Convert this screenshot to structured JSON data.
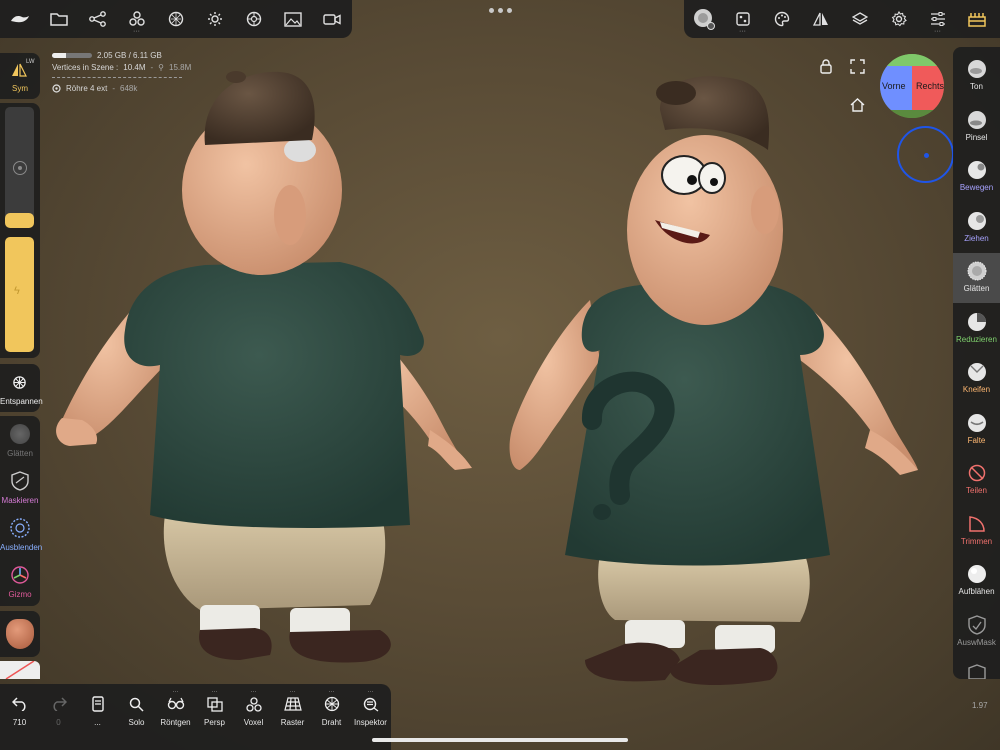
{
  "top_left_tools": [
    {
      "name": "logo-icon"
    },
    {
      "name": "folder-icon"
    },
    {
      "name": "scene-graph-icon"
    },
    {
      "name": "primitives-icon",
      "has_menu": true
    },
    {
      "name": "material-icon"
    },
    {
      "name": "light-icon"
    },
    {
      "name": "environment-icon"
    },
    {
      "name": "image-icon"
    },
    {
      "name": "video-icon"
    }
  ],
  "top_right_tools": [
    {
      "name": "brush-preview-icon"
    },
    {
      "name": "stroke-icon",
      "has_menu": true
    },
    {
      "name": "palette-icon"
    },
    {
      "name": "symmetry-icon"
    },
    {
      "name": "layers-icon"
    },
    {
      "name": "settings-icon"
    },
    {
      "name": "sliders-icon",
      "has_menu": true
    },
    {
      "name": "scene-icon"
    }
  ],
  "info": {
    "memory": "2.05 GB / 6.11 GB",
    "memory_fraction": 0.34,
    "vertices_label": "Vertices in Szene :",
    "vertices_value": "10.4M",
    "vertices_sep": "-",
    "vertices_total": "15.8M",
    "object_name": "Röhre 4 ext",
    "object_sep": "-",
    "object_count": "648k"
  },
  "left": {
    "sym_label": "Sym",
    "sym_badge": "LW",
    "relax_label": "Entspannen",
    "smooth_label": "Glätten",
    "mask_label": "Maskieren",
    "hide_label": "Ausblenden",
    "gizmo_label": "Gizmo"
  },
  "right_tools": [
    {
      "label": "Ton",
      "icon": "clay-brush-icon",
      "color": "#e6e6e6"
    },
    {
      "label": "Pinsel",
      "icon": "brush-icon",
      "color": "#e6e6e6"
    },
    {
      "label": "Bewegen",
      "icon": "move-icon",
      "color": "#a8a3ff"
    },
    {
      "label": "Ziehen",
      "icon": "drag-icon",
      "color": "#a8a3ff"
    },
    {
      "label": "Glätten",
      "icon": "smooth-icon",
      "color": "#e6e6e6",
      "active": true
    },
    {
      "label": "Reduzieren",
      "icon": "flatten-icon",
      "color": "#7fd16d"
    },
    {
      "label": "Kneifen",
      "icon": "pinch-icon",
      "color": "#ffb872"
    },
    {
      "label": "Falte",
      "icon": "crease-icon",
      "color": "#ffb872"
    },
    {
      "label": "Teilen",
      "icon": "split-icon",
      "color": "#f0716d"
    },
    {
      "label": "Trimmen",
      "icon": "trim-icon",
      "color": "#f0716d"
    },
    {
      "label": "Aufblähen",
      "icon": "inflate-icon",
      "color": "#e6e6e6"
    },
    {
      "label": "AuswMask",
      "icon": "select-mask-icon",
      "color": "#9a9a9a"
    }
  ],
  "gizmo": {
    "front_label": "Vorne",
    "right_label": "Rechts"
  },
  "bottom": [
    {
      "label": "710",
      "icon": "undo-icon"
    },
    {
      "label": "0",
      "icon": "redo-icon",
      "dim": true
    },
    {
      "label": "...",
      "icon": "notebook-icon"
    },
    {
      "label": "Solo",
      "icon": "search-icon"
    },
    {
      "label": "Röntgen",
      "icon": "xray-icon",
      "has_menu": true
    },
    {
      "label": "Persp",
      "icon": "perspective-icon",
      "has_menu": true
    },
    {
      "label": "Voxel",
      "icon": "voxel-icon",
      "has_menu": true
    },
    {
      "label": "Raster",
      "icon": "grid-icon",
      "has_menu": true
    },
    {
      "label": "Draht",
      "icon": "wireframe-icon",
      "has_menu": true
    },
    {
      "label": "Inspektor",
      "icon": "inspector-icon",
      "has_menu": true
    }
  ],
  "zoom": "1.97",
  "colors": {
    "accent": "#f1c65c",
    "panel": "#1e1e1e",
    "shirt": "#2f4a42",
    "skin": "#e5b08f",
    "cap": "#4b3b2e"
  }
}
